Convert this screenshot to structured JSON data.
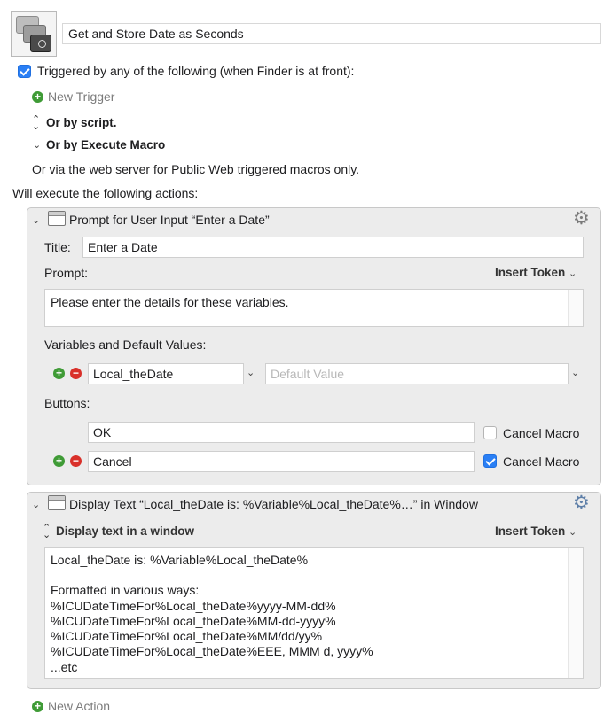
{
  "macro": {
    "name": "Get and Store Date as Seconds"
  },
  "trigger": {
    "checkbox_label": "Triggered by any of the following (when Finder is at front):",
    "new_trigger": "New Trigger",
    "or_by_script": "Or by script.",
    "or_by_execute_macro": "Or by Execute Macro",
    "web_server_note": "Or via the web server for Public Web triggered macros only."
  },
  "actions_header": "Will execute the following actions:",
  "action1": {
    "title": "Prompt for User Input “Enter a Date”",
    "title_label": "Title:",
    "title_value": "Enter a Date",
    "prompt_label": "Prompt:",
    "insert_token": "Insert Token",
    "prompt_value": "Please enter the details for these variables.",
    "variables_label": "Variables and Default Values:",
    "variable_name": "Local_theDate",
    "default_placeholder": "Default Value",
    "buttons_label": "Buttons:",
    "buttons": [
      {
        "label": "OK",
        "cancel_label": "Cancel Macro",
        "cancel_checked": false
      },
      {
        "label": "Cancel",
        "cancel_label": "Cancel Macro",
        "cancel_checked": true
      }
    ]
  },
  "action2": {
    "title": "Display Text “Local_theDate is: %Variable%Local_theDate%…” in Window",
    "mode": "Display text in a window",
    "insert_token": "Insert Token",
    "text_lines": [
      "Local_theDate is: %Variable%Local_theDate%",
      "",
      "Formatted in various ways:",
      "%ICUDateTimeFor%Local_theDate%yyyy-MM-dd%",
      "%ICUDateTimeFor%Local_theDate%MM-dd-yyyy%",
      "%ICUDateTimeFor%Local_theDate%MM/dd/yy%",
      "%ICUDateTimeFor%Local_theDate%EEE, MMM d, yyyy%",
      "...etc"
    ]
  },
  "new_action": "New Action",
  "colors": {
    "accent_blue": "#2a7ff5",
    "add_green": "#3f9b36",
    "remove_red": "#d9302a",
    "action_bg": "#ececec"
  },
  "icons": [
    "macro-group-icon",
    "add-icon",
    "remove-icon",
    "gear-icon",
    "window-icon",
    "disclosure-chevron-icon",
    "updown-chevron-icon"
  ]
}
